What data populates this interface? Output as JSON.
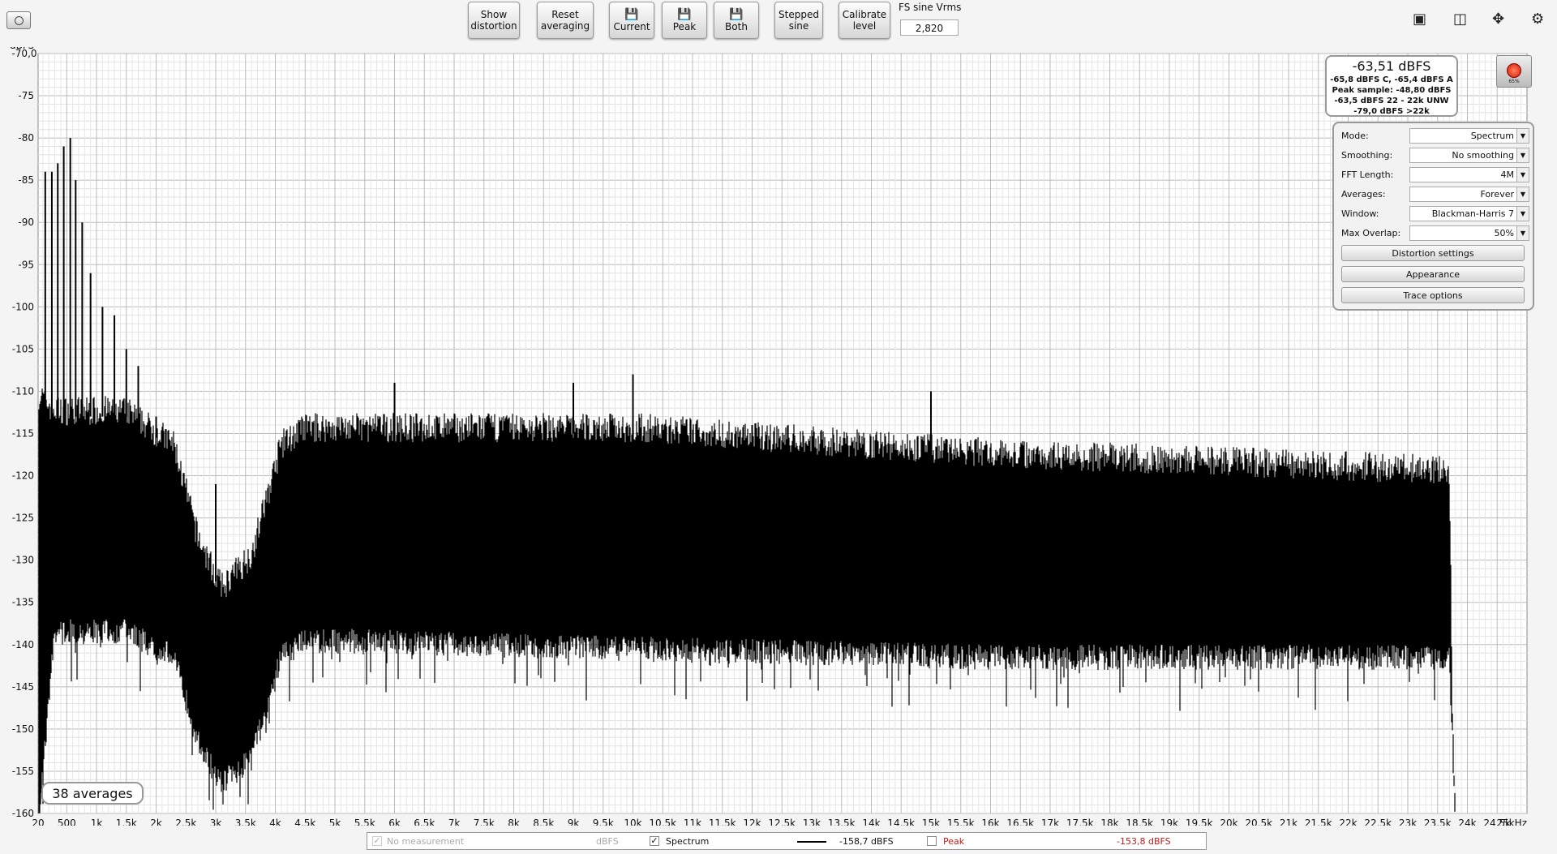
{
  "toolbar": {
    "show_distortion": "Show\ndistortion",
    "reset_averaging": "Reset\naveraging",
    "current": "Current",
    "peak": "Peak",
    "both": "Both",
    "stepped_sine": "Stepped\nsine",
    "calibrate_level": "Calibrate\nlevel",
    "fs_label": "FS sine Vrms",
    "fs_value": "2,820"
  },
  "readout": {
    "main": "-63,51 dBFS",
    "line1": "-65,8 dBFS C, -65,4 dBFS A",
    "line2": "Peak sample: -48,80 dBFS",
    "line3": "-63,5 dBFS 22 - 22k UNW",
    "line4": "-79,0 dBFS >22k",
    "record_level": "65%"
  },
  "settings": {
    "mode_label": "Mode:",
    "mode_value": "Spectrum",
    "smoothing_label": "Smoothing:",
    "smoothing_value": "No  smoothing",
    "fft_label": "FFT Length:",
    "fft_value": "4M",
    "averages_label": "Averages:",
    "averages_value": "Forever",
    "window_label": "Window:",
    "window_value": "Blackman-Harris 7",
    "overlap_label": "Max Overlap:",
    "overlap_value": "50%",
    "distortion_settings": "Distortion settings",
    "appearance": "Appearance",
    "trace_options": "Trace options"
  },
  "averages_badge": "38 averages",
  "legend": {
    "no_measurement": "No measurement",
    "no_measurement_unit": "dBFS",
    "spectrum": "Spectrum",
    "spectrum_value": "-158,7 dBFS",
    "peak": "Peak",
    "peak_value": "-153,8 dBFS"
  },
  "colors": {
    "trace": "#000000",
    "peak": "#c81818",
    "grid": "#cccccc",
    "plot_bg": "#ffffff"
  },
  "icons": [
    "camera-icon",
    "save-icon",
    "layout-icon",
    "columns-icon",
    "zoom-arrows-icon",
    "gear-icon"
  ],
  "chart_data": {
    "type": "line",
    "title": "",
    "ylabel": "dBFS",
    "xlabel": "",
    "ylim": [
      -160,
      -70
    ],
    "xlim": [
      20,
      25000
    ],
    "y_top_value": "-70,0",
    "x_first_value": "20",
    "yticks": [
      "-75",
      "-80",
      "-85",
      "-90",
      "-95",
      "-100",
      "-105",
      "-110",
      "-115",
      "-120",
      "-125",
      "-130",
      "-135",
      "-140",
      "-145",
      "-150",
      "-155",
      "-160"
    ],
    "xticks": [
      {
        "v": 500,
        "l": "500"
      },
      {
        "v": 1000,
        "l": "1k"
      },
      {
        "v": 1500,
        "l": "1,5k"
      },
      {
        "v": 2000,
        "l": "2k"
      },
      {
        "v": 2500,
        "l": "2,5k"
      },
      {
        "v": 3000,
        "l": "3k"
      },
      {
        "v": 3500,
        "l": "3,5k"
      },
      {
        "v": 4000,
        "l": "4k"
      },
      {
        "v": 4500,
        "l": "4,5k"
      },
      {
        "v": 5000,
        "l": "5k"
      },
      {
        "v": 5500,
        "l": "5,5k"
      },
      {
        "v": 6000,
        "l": "6k"
      },
      {
        "v": 6500,
        "l": "6,5k"
      },
      {
        "v": 7000,
        "l": "7k"
      },
      {
        "v": 7500,
        "l": "7,5k"
      },
      {
        "v": 8000,
        "l": "8k"
      },
      {
        "v": 8500,
        "l": "8,5k"
      },
      {
        "v": 9000,
        "l": "9k"
      },
      {
        "v": 9500,
        "l": "9,5k"
      },
      {
        "v": 10000,
        "l": "10k"
      },
      {
        "v": 10500,
        "l": "10,5k"
      },
      {
        "v": 11000,
        "l": "11k"
      },
      {
        "v": 11500,
        "l": "11,5k"
      },
      {
        "v": 12000,
        "l": "12k"
      },
      {
        "v": 12500,
        "l": "12,5k"
      },
      {
        "v": 13000,
        "l": "13k"
      },
      {
        "v": 13500,
        "l": "13,5k"
      },
      {
        "v": 14000,
        "l": "14k"
      },
      {
        "v": 14500,
        "l": "14,5k"
      },
      {
        "v": 15000,
        "l": "15k"
      },
      {
        "v": 15500,
        "l": "15,5k"
      },
      {
        "v": 16000,
        "l": "16k"
      },
      {
        "v": 16500,
        "l": "16,5k"
      },
      {
        "v": 17000,
        "l": "17k"
      },
      {
        "v": 17500,
        "l": "17,5k"
      },
      {
        "v": 18000,
        "l": "18k"
      },
      {
        "v": 18500,
        "l": "18,5k"
      },
      {
        "v": 19000,
        "l": "19k"
      },
      {
        "v": 19500,
        "l": "19,5k"
      },
      {
        "v": 20000,
        "l": "20k"
      },
      {
        "v": 20500,
        "l": "20,5k"
      },
      {
        "v": 21000,
        "l": "21k"
      },
      {
        "v": 21500,
        "l": "21,5k"
      },
      {
        "v": 22000,
        "l": "22k"
      },
      {
        "v": 22500,
        "l": "22,5k"
      },
      {
        "v": 23000,
        "l": "23k"
      },
      {
        "v": 23500,
        "l": "23,5k"
      },
      {
        "v": 24000,
        "l": "24k"
      },
      {
        "v": 24500,
        "l": "24,5k"
      },
      {
        "v": 25000,
        "l": "25kHz"
      }
    ],
    "series": [
      {
        "envelope_top": [
          [
            20,
            -111
          ],
          [
            300,
            -113
          ],
          [
            1500,
            -113
          ],
          [
            2300,
            -117
          ],
          [
            2700,
            -128
          ],
          [
            3100,
            -134
          ],
          [
            3600,
            -130
          ],
          [
            4100,
            -117
          ],
          [
            4500,
            -115
          ],
          [
            10000,
            -115
          ],
          [
            16000,
            -118
          ],
          [
            23700,
            -120
          ],
          [
            23750,
            -150
          ],
          [
            23800,
            -160
          ]
        ],
        "envelope_bottom": [
          [
            20,
            -160
          ],
          [
            300,
            -137
          ],
          [
            1500,
            -137
          ],
          [
            2300,
            -140
          ],
          [
            2700,
            -150
          ],
          [
            3100,
            -155
          ],
          [
            3600,
            -152
          ],
          [
            4100,
            -140
          ],
          [
            4500,
            -138
          ],
          [
            10000,
            -139
          ],
          [
            16000,
            -140
          ],
          [
            23700,
            -140
          ],
          [
            23800,
            -160
          ]
        ],
        "spikes": [
          [
            140,
            -84
          ],
          [
            250,
            -84
          ],
          [
            350,
            -83
          ],
          [
            450,
            -81
          ],
          [
            560,
            -80
          ],
          [
            650,
            -85
          ],
          [
            760,
            -90
          ],
          [
            900,
            -96
          ],
          [
            1100,
            -100
          ],
          [
            1300,
            -101
          ],
          [
            1500,
            -105
          ],
          [
            1700,
            -107
          ],
          [
            2000,
            -113
          ],
          [
            3000,
            -121
          ],
          [
            4000,
            -127
          ],
          [
            6000,
            -109
          ],
          [
            9000,
            -109
          ],
          [
            10000,
            -108
          ],
          [
            12000,
            -114
          ],
          [
            15000,
            -110
          ],
          [
            19500,
            -122
          ],
          [
            23500,
            -120
          ]
        ]
      }
    ]
  }
}
